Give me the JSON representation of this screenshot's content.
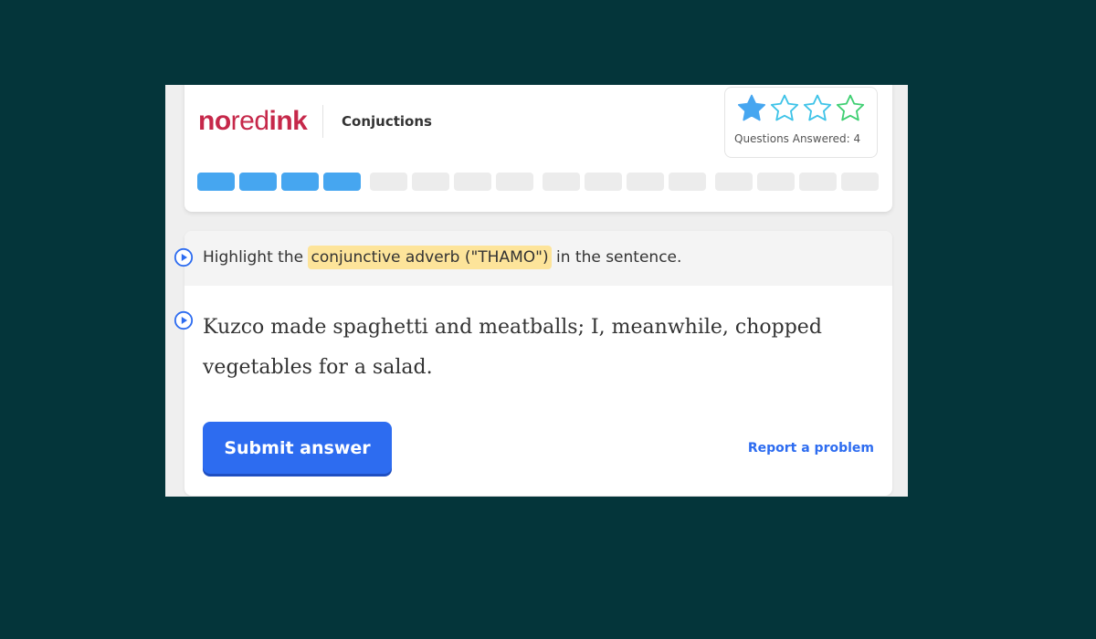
{
  "header": {
    "logo": {
      "part1": "no",
      "part2": "red",
      "part3": "ink"
    },
    "topic": "Conjuctions",
    "rating": {
      "filled_stars": 1,
      "total_stars": 4,
      "star_icons": [
        "star-filled-icon",
        "star-outline-icon",
        "star-outline-icon",
        "star-outline-icon"
      ]
    },
    "questions_answered_label": "Questions Answered: 4",
    "progress": {
      "completed": 4,
      "total": 16
    }
  },
  "question": {
    "prompt_before": "Highlight the ",
    "prompt_highlight": "conjunctive adverb (\"THAMO\")",
    "prompt_after": " in the sentence.",
    "sentence": "Kuzco made spaghetti and meatballs; I, meanwhile, chopped vegetables for a salad.",
    "icon": "play-circle-icon"
  },
  "actions": {
    "submit_label": "Submit answer",
    "report_label": "Report a problem"
  },
  "colors": {
    "background": "#04353a",
    "brand": "#c6284a",
    "accent": "#2d6cf0",
    "progress_done": "#46a6f0",
    "highlight": "#fde49a"
  }
}
